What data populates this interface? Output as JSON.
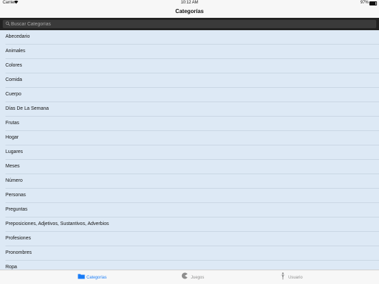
{
  "status": {
    "carrier": "Carrier",
    "time": "10:12 AM",
    "battery": "97%"
  },
  "navbar": {
    "title": "Categorías"
  },
  "search": {
    "placeholder": "Buscar Categorías"
  },
  "categories": [
    "Abecedario",
    "Animales",
    "Colores",
    "Comida",
    "Cuerpo",
    "Días De La Semana",
    "Frutas",
    "Hogar",
    "Lugares",
    "Meses",
    "Número",
    "Personas",
    "Preguntas",
    "Preposiciones, Adjetivos, Sustantivos, Adverbios",
    "Profesiones",
    "Pronombres",
    "Ropa"
  ],
  "tabs": [
    {
      "label": "Categorías",
      "icon": "folder-icon",
      "active": true
    },
    {
      "label": "Juegos",
      "icon": "pacman-icon",
      "active": false
    },
    {
      "label": "Usuario",
      "icon": "person-icon",
      "active": false
    }
  ],
  "colors": {
    "accent": "#1a7cf7",
    "list_background": "#dde9f5",
    "search_background": "#222222"
  }
}
